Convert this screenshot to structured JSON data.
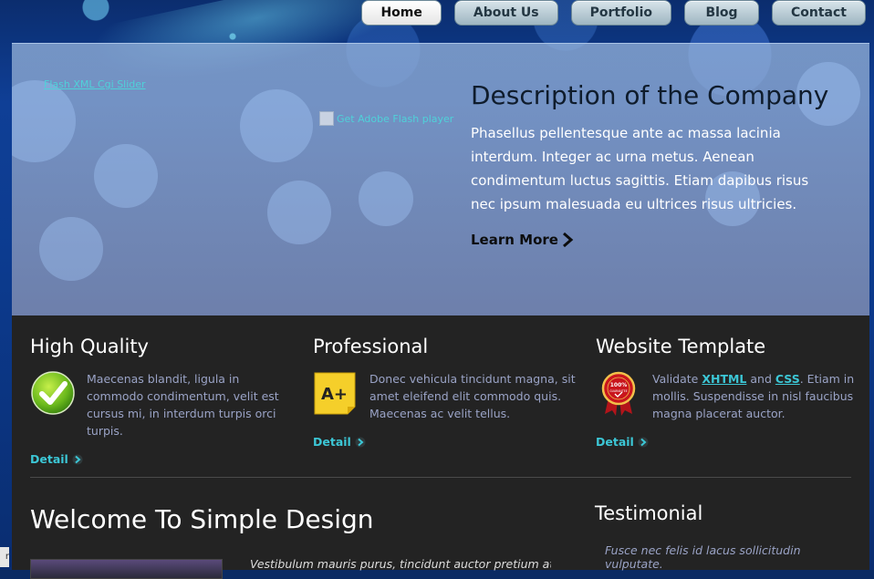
{
  "nav": {
    "items": [
      {
        "label": "Home",
        "active": true
      },
      {
        "label": "About Us",
        "active": false
      },
      {
        "label": "Portfolio",
        "active": false
      },
      {
        "label": "Blog",
        "active": false
      },
      {
        "label": "Contact",
        "active": false
      }
    ]
  },
  "hero": {
    "flash_link": "Flash XML Cgi Slider",
    "broken_image_alt": "Get Adobe Flash player",
    "title": "Description of the Company",
    "text": "Phasellus pellentesque ante ac massa lacinia interdum. Integer ac urna metus. Aenean condimentum luctus sagittis. Etiam dapibus risus nec ipsum malesuada eu ultrices risus ultricies.",
    "learn_more": "Learn More"
  },
  "features": [
    {
      "title": "High Quality",
      "icon": "checkmark-icon",
      "text": "Maecenas blandit, ligula in commodo condimentum, velit est cursus mi, in interdum turpis orci turpis.",
      "detail": "Detail"
    },
    {
      "title": "Professional",
      "icon": "a-plus-note-icon",
      "text": "Donec vehicula tincidunt magna, sit amet eleifend elit commodo quis. Maecenas ac velit tellus.",
      "detail": "Detail"
    },
    {
      "title": "Website Template",
      "icon": "guarantee-badge-icon",
      "text_prefix": "Validate ",
      "link1": "XHTML",
      "text_mid": " and ",
      "link2": "CSS",
      "text_suffix": ". Etiam in mollis. Suspendisse in nisl faucibus magna placerat auctor.",
      "detail": "Detail"
    }
  ],
  "welcome": {
    "title": "Welcome To Simple Design",
    "text": "Vestibulum mauris purus, tincidunt auctor pretium at"
  },
  "testimonial": {
    "title": "Testimonial",
    "text": "Fusce nec felis id lacus sollicitudin vulputate."
  },
  "corner_tab": "r",
  "colors": {
    "accent": "#3cc7d6",
    "content_bg": "#232323",
    "body_text": "#9aa3c6"
  }
}
